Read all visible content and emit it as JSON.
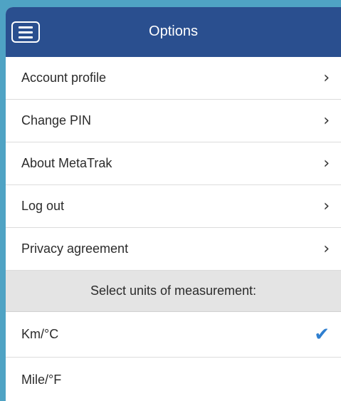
{
  "header": {
    "title": "Options",
    "menu_icon": "hamburger-menu-icon"
  },
  "menu_items": [
    {
      "label": "Account profile",
      "icon": "chevron-right-icon"
    },
    {
      "label": "Change PIN",
      "icon": "chevron-right-icon"
    },
    {
      "label": "About MetaTrak",
      "icon": "chevron-right-icon"
    },
    {
      "label": "Log out",
      "icon": "chevron-right-icon"
    },
    {
      "label": "Privacy agreement",
      "icon": "chevron-right-icon"
    }
  ],
  "units": {
    "section_title": "Select units of measurement:",
    "options": [
      {
        "label": "Km/°C",
        "selected": true
      },
      {
        "label": "Mile/°F",
        "selected": false
      }
    ]
  },
  "colors": {
    "header": "#2a4f8f",
    "check": "#2f7fd0",
    "section_bg": "#e4e4e4"
  }
}
